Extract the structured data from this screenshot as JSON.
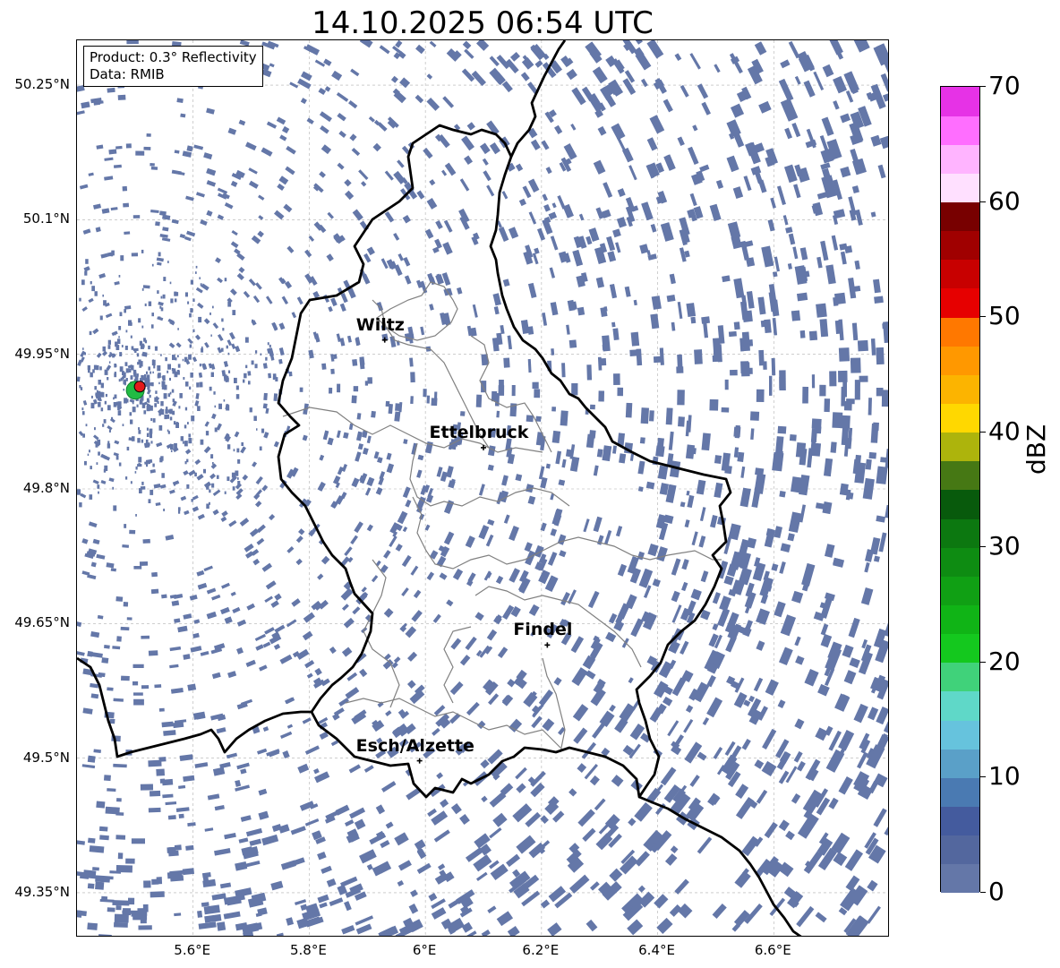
{
  "title": "14.10.2025 06:54 UTC",
  "info_box": {
    "product": "Product: 0.3° Reflectivity",
    "data_source": "Data: RMIB"
  },
  "map": {
    "extent": {
      "lon_min": 5.4,
      "lon_max": 6.8,
      "lat_min": 49.3,
      "lat_max": 50.3
    },
    "lat_ticks": [
      {
        "value": 50.25,
        "label": "50.25°N"
      },
      {
        "value": 50.1,
        "label": "50.1°N"
      },
      {
        "value": 49.95,
        "label": "49.95°N"
      },
      {
        "value": 49.8,
        "label": "49.8°N"
      },
      {
        "value": 49.65,
        "label": "49.65°N"
      },
      {
        "value": 49.5,
        "label": "49.5°N"
      },
      {
        "value": 49.35,
        "label": "49.35°N"
      }
    ],
    "lon_ticks": [
      {
        "value": 5.6,
        "label": "5.6°E"
      },
      {
        "value": 5.8,
        "label": "5.8°E"
      },
      {
        "value": 6.0,
        "label": "6°E"
      },
      {
        "value": 6.2,
        "label": "6.2°E"
      },
      {
        "value": 6.4,
        "label": "6.4°E"
      },
      {
        "value": 6.6,
        "label": "6.6°E"
      }
    ],
    "gridlines": true,
    "cities": [
      {
        "name": "Wiltz",
        "lon": 5.93,
        "lat": 49.966
      },
      {
        "name": "Ettelbruck",
        "lon": 6.1,
        "lat": 49.846
      },
      {
        "name": "Findel",
        "lon": 6.21,
        "lat": 49.626
      },
      {
        "name": "Esch/Alzette",
        "lon": 5.99,
        "lat": 49.497
      }
    ],
    "radar_site": {
      "lon": 5.505,
      "lat": 49.914,
      "color": "#e31a1c",
      "halo_color": "#22bb44"
    },
    "echo_color": "#6477a8",
    "border_color": "#000000",
    "canton_color": "#808080"
  },
  "colorbar": {
    "label": "dBZ",
    "min": 0,
    "max": 70,
    "colors": [
      "#6477a8",
      "#53679e",
      "#445b9e",
      "#4a7ab2",
      "#5aa0c8",
      "#66c3dd",
      "#5fd8c8",
      "#40d27a",
      "#14c81e",
      "#10b416",
      "#10a014",
      "#0e8c12",
      "#0c7810",
      "#085a0c",
      "#467814",
      "#adb40c",
      "#ffd800",
      "#fcb400",
      "#ff9800",
      "#ff7800",
      "#e60000",
      "#c80000",
      "#a00000",
      "#780000",
      "#ffe0ff",
      "#ffb4ff",
      "#ff6eff",
      "#e632e6"
    ],
    "ticks": [
      {
        "value": 0,
        "label": "0"
      },
      {
        "value": 10,
        "label": "10"
      },
      {
        "value": 20,
        "label": "20"
      },
      {
        "value": 30,
        "label": "30"
      },
      {
        "value": 40,
        "label": "40"
      },
      {
        "value": 50,
        "label": "50"
      },
      {
        "value": 60,
        "label": "60"
      },
      {
        "value": 70,
        "label": "70"
      }
    ]
  }
}
